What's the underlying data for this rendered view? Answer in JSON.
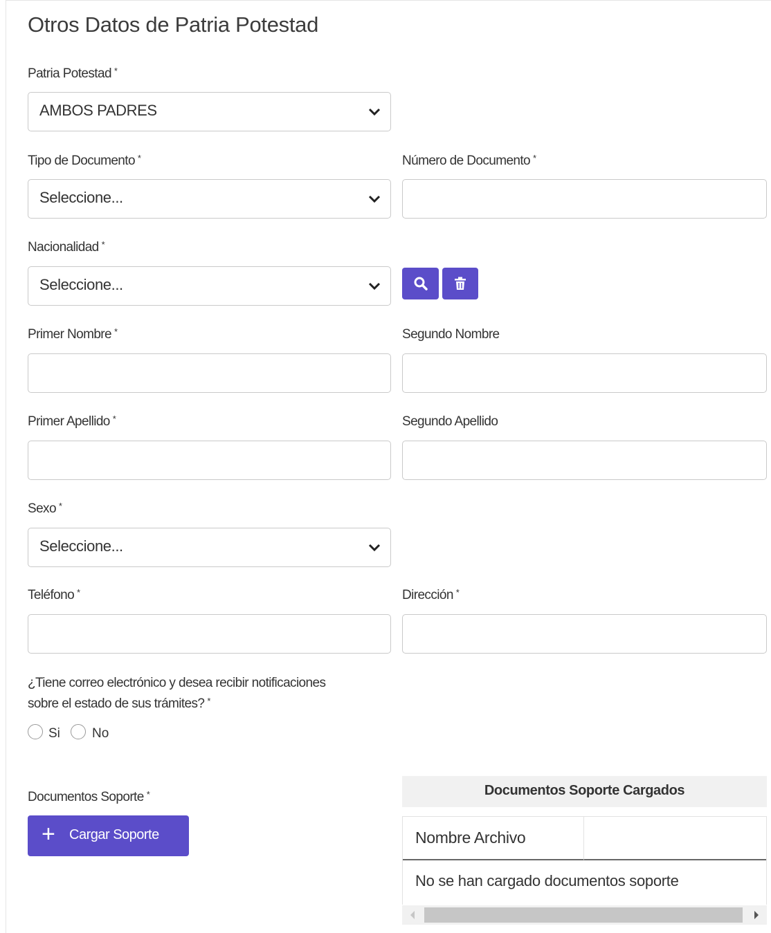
{
  "section_title": "Otros Datos de Patria Potestad",
  "required_mark": "*",
  "fields": {
    "patria_potestad": {
      "label": "Patria Potestad",
      "value": "AMBOS PADRES"
    },
    "tipo_documento": {
      "label": "Tipo de Documento",
      "value": "Seleccione..."
    },
    "numero_documento": {
      "label": "Número de Documento",
      "value": ""
    },
    "nacionalidad": {
      "label": "Nacionalidad",
      "value": "Seleccione..."
    },
    "primer_nombre": {
      "label": "Primer Nombre",
      "value": ""
    },
    "segundo_nombre": {
      "label": "Segundo Nombre",
      "value": ""
    },
    "primer_apellido": {
      "label": "Primer Apellido",
      "value": ""
    },
    "segundo_apellido": {
      "label": "Segundo Apellido",
      "value": ""
    },
    "sexo": {
      "label": "Sexo",
      "value": "Seleccione..."
    },
    "telefono": {
      "label": "Teléfono",
      "value": ""
    },
    "direccion": {
      "label": "Dirección",
      "value": ""
    }
  },
  "email_question": {
    "line1": "¿Tiene correo electrónico y desea recibir notificaciones",
    "line2": "sobre el estado de sus trámites?",
    "options": [
      "Si",
      "No"
    ]
  },
  "support_docs": {
    "label": "Documentos Soporte",
    "button_label": "Cargar Soporte",
    "button_icon": "plus-icon",
    "table_title": "Documentos Soporte Cargados",
    "column_header": "Nombre Archivo",
    "empty_message": "No se han cargado documentos soporte"
  },
  "icons": {
    "search": "search-icon",
    "delete": "trash-icon",
    "dropdown": "chevron-down-icon"
  },
  "colors": {
    "primary": "#5b4dc9",
    "border": "#c9c9c9",
    "table_header_bg": "#f1f1f1"
  }
}
